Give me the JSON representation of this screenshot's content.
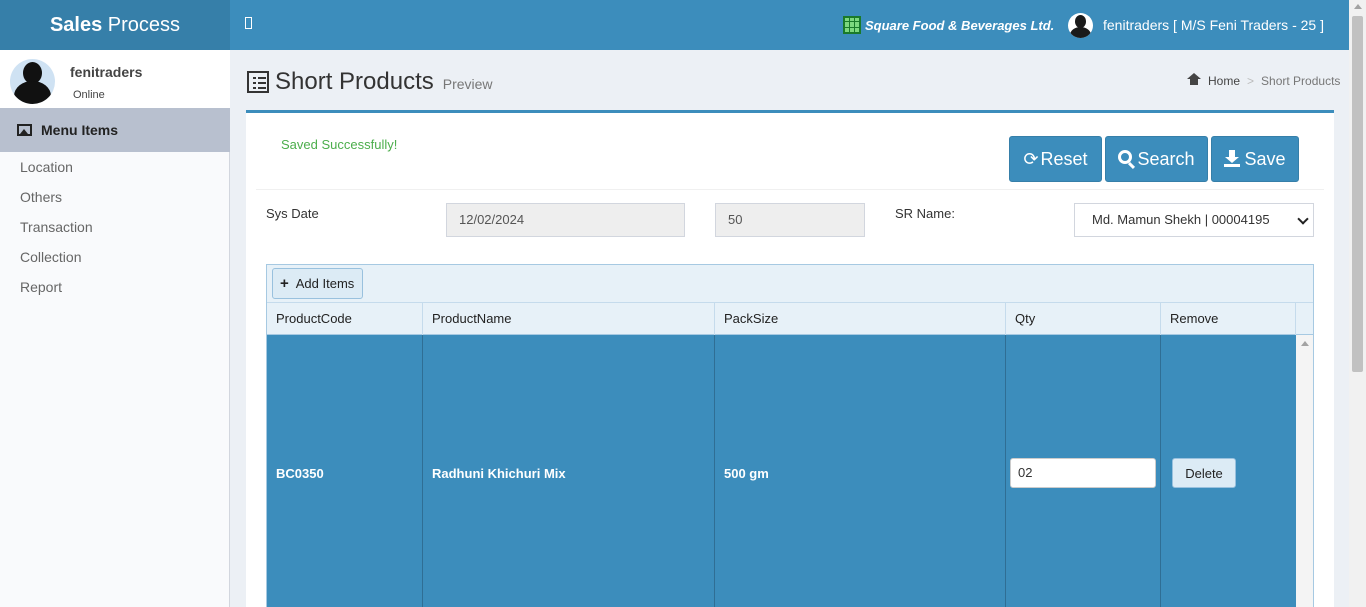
{
  "header": {
    "logo_bold": "Sales",
    "logo_rest": " Process",
    "company": "Square Food & Beverages Ltd.",
    "user_account": "fenitraders [ M/S Feni Traders - 25 ]"
  },
  "sidebar": {
    "user_name": "fenitraders",
    "user_status": "Online",
    "menu_header": "Menu Items",
    "items": [
      {
        "label": "Location"
      },
      {
        "label": "Others"
      },
      {
        "label": "Transaction"
      },
      {
        "label": "Collection"
      },
      {
        "label": "Report"
      }
    ]
  },
  "page": {
    "title": "Short Products",
    "subtitle": "Preview",
    "breadcrumb": {
      "home": "Home",
      "sep": ">",
      "current": "Short Products"
    }
  },
  "form": {
    "message": "Saved Successfully!",
    "buttons": {
      "reset": "Reset",
      "search": "Search",
      "save": "Save"
    },
    "sys_date_label": "Sys Date",
    "sys_date_value": "12/02/2024",
    "number_value": "50",
    "sr_label": "SR Name:",
    "sr_selected": "Md. Mamun Shekh | 00004195"
  },
  "grid": {
    "add_label": "Add Items",
    "columns": [
      "ProductCode",
      "ProductName",
      "PackSize",
      "Qty",
      "Remove"
    ],
    "rows": [
      {
        "code": "BC0350",
        "name": "Radhuni Khichuri Mix",
        "pack": "500 gm",
        "qty": "02",
        "remove": "Delete"
      }
    ]
  },
  "colors": {
    "primary": "#3c8dbc",
    "logo_bg": "#367fa9",
    "success": "#4cae4c"
  }
}
